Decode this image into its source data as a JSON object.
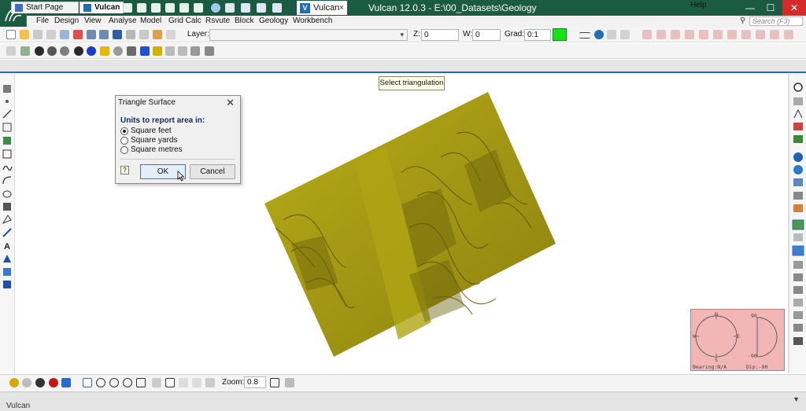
{
  "titlebar": {
    "app_tab_badge": "V",
    "app_tab_label": "Vulcan",
    "app_tab_close": "×",
    "window_title": "Vulcan 12.0.3 - E:\\00_Datasets\\Geology",
    "min_glyph": "—",
    "max_glyph": "☐",
    "close_glyph": "✕"
  },
  "menu": {
    "items": [
      "File",
      "Design",
      "View",
      "Analyse",
      "Model",
      "Grid Calc",
      "Rsvute",
      "Block",
      "Geology",
      "Workbench"
    ],
    "help": "Help",
    "search_placeholder": "Search (F3)"
  },
  "toolbar1": {
    "layer_label": "Layer:",
    "layer_value": "",
    "z_label": "Z:",
    "z_value": "0",
    "w_label": "W:",
    "w_value": "0",
    "grad_label": "Grad:",
    "grad_value": "0:1"
  },
  "tabs": [
    {
      "label": "Start Page"
    },
    {
      "label": "Vulcan"
    }
  ],
  "tooltip": "Select triangulation",
  "dialog": {
    "title": "Triangle Surface",
    "close": "✕",
    "group_label": "Units to report area in:",
    "options": [
      "Square feet",
      "Square yards",
      "Square metres"
    ],
    "selected_index": 0,
    "help_glyph": "?",
    "ok_label": "OK",
    "cancel_label": "Cancel"
  },
  "compass": {
    "north": "N",
    "south": "S",
    "east": "E",
    "west": "W",
    "dip_top": "90",
    "dip_bottom": "-90",
    "bearing": "Bearing:N/A",
    "dip": "Dip:-90"
  },
  "bottom_toolbar": {
    "zoom_label": "Zoom:",
    "zoom_value": "0.8"
  },
  "status": {
    "app_label": "Vulcan",
    "arrow": "▼"
  },
  "colors": {
    "titlebar": "#1c5b43",
    "surface": "#a59a10",
    "compass_bg": "#f3b6b6",
    "accent_blue": "#1f6fb6",
    "swatch_green": "#16e316"
  }
}
